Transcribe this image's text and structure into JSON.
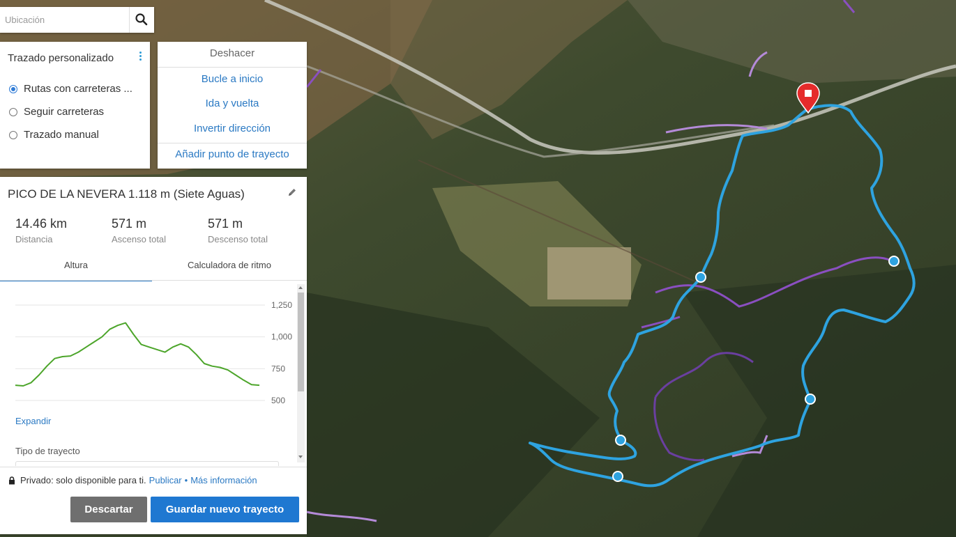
{
  "search": {
    "placeholder": "Ubicación",
    "icon": "search-icon"
  },
  "routing": {
    "title": "Trazado personalizado",
    "options": [
      {
        "label": "Rutas con carreteras ...",
        "selected": true
      },
      {
        "label": "Seguir carreteras",
        "selected": false
      },
      {
        "label": "Trazado manual",
        "selected": false
      }
    ]
  },
  "tools": {
    "undo": "Deshacer",
    "loop": "Bucle a inicio",
    "out_back": "Ida y vuelta",
    "reverse": "Invertir dirección",
    "add_waypoint": "Añadir punto de trayecto"
  },
  "route": {
    "name": "PICO DE LA NEVERA 1.118 m (Siete Aguas)",
    "distance": {
      "value": "14.46 km",
      "label": "Distancia"
    },
    "ascent": {
      "value": "571 m",
      "label": "Ascenso total"
    },
    "descent": {
      "value": "571 m",
      "label": "Descenso total"
    }
  },
  "tabs": {
    "elevation": "Altura",
    "pace": "Calculadora de ritmo"
  },
  "chart_data": {
    "type": "area",
    "y_ticks": [
      "1,250",
      "1,000",
      "750",
      "500"
    ],
    "ylim": [
      500,
      1250
    ],
    "series": [
      {
        "values": [
          620,
          615,
          640,
          700,
          770,
          830,
          845,
          850,
          880,
          920,
          960,
          1000,
          1060,
          1090,
          1110,
          1020,
          940,
          920,
          900,
          880,
          920,
          945,
          920,
          860,
          790,
          770,
          760,
          740,
          700,
          660,
          625,
          620
        ],
        "color": "#4ca52a"
      }
    ]
  },
  "labels": {
    "expand": "Expandir",
    "route_type": "Tipo de trayecto",
    "privacy_text": "Privado: solo disponible para ti.",
    "publish": "Publicar",
    "bullet": "•",
    "more_info": "Más información",
    "discard": "Descartar",
    "save": "Guardar nuevo trayecto"
  },
  "colors": {
    "route": "#2ea3e0",
    "trail": "#8a4fc0",
    "accent": "#1f78d1",
    "elevation": "#4ca52a"
  }
}
